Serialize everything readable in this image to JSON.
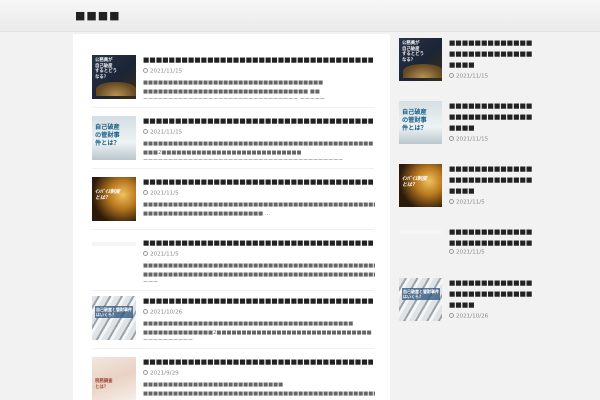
{
  "header": {
    "site_title": "■■■■"
  },
  "main": {
    "posts": [
      {
        "title": "■■■■■■■■■■■■■■■■■■■■■■■■■■■■■■■■■■■■■■■■",
        "date": "2021/11/15",
        "excerpt": "■■■■■■■■■■■■■■■■■■■■■■■■■■■■■■■■■■■■ ■■■■■■■■■■■■■■■■■■■■■■■■■■■■■■■■■ ■■ ■■■■■■■■■■■■■■■■■■■■■■■■■■■■■■■ ■■■■■ …",
        "thumb_text": "公務員が\n自己破産\nするとどう\nなる？"
      },
      {
        "title": "■■■■■■■■■■■■■■■■■■■■■■■■■■■■■■■■■■■■■■■■■■",
        "date": "2021/11/15",
        "excerpt": "■■■■■■■■■■■■■■■■■■■■■■■■■■■■■■■■■■■■■■■■■■■■■■ ■■■2■■■■■■■■■■■■■■■■■■■■■■■■■■■■ ■■■■■■■■■■■■■■■■■■■■■■■■■■■■■■■■■■■■■■■■ …",
        "thumb_text": "自己破産\nの管財事\n件とは？"
      },
      {
        "title": "■■■■■■■■■■■■■■■■■■■■■■■■■■■■■■■■■■■■■■■■",
        "date": "2021/11/5",
        "excerpt": "■■■■■■■■■■■■■■■■■■■■■■■■■■■■■■■■■■■■■■■■■■■■■■■■■■■■■■■■■■■■■■■■■■■■■■■■■■■■■■■■■■■■■ ■■■■■■■■■■■■■■■■■■■■■■■■ …",
        "thumb_text": "ｲﾝﾊﾞｲｽ制度\nとは？"
      },
      {
        "title": "■■■■■■■■■■■■■■■■■■■■■■■■■■■■■■■■■■■■■■",
        "date": "2021/11/5",
        "excerpt": "■■■■■■■■■■■■■■■■■■■■■■■■■■■■■■■■■■■■■■■■■■■■■■■■■ ■■■■■■■■■■■■■■■■■■■■■■■■■■■■■■■■■■■■■■■■■■■■■■■■■■ ■■■ …",
        "thumb_text": ""
      },
      {
        "title": "■■■■■■■■■■■■■■■■■■■■■■■■■■■■■■■■■■■■■■■■■",
        "date": "2021/10/26",
        "excerpt": "■■■■■■■■■■■■■■■■■■■■■■■■■■■■■■■■■■■■■■■■■■ ■■■■■■■■■■■■■■2■■■■■■■■■■■■■■■■■■■■■■■■■■■■■■■ ■■■■■■■■■■ …",
        "thumb_text": "自己破産と管財事件\nはいくら？"
      },
      {
        "title": "■■■■■■■■■■■■■■■■■■■■■■■■■■■■■■■■■■■■■■■■",
        "date": "2021/9/29",
        "excerpt": "■■■■■■■■■■■■■■■■■■■■■■■■■■■■ ■■■■■■■■■■■■■■■■■■■■■■■■■■■■■■■■■■■■■■■■■■■■■■■■■■■■■■■■■ ■■■■■■■■■■ …",
        "thumb_text": "税務調査\nとは？"
      }
    ]
  },
  "sidebar": {
    "items": [
      {
        "title": "■■■■■■■■■■■■■■■■■■■■■■■■■■■■■■",
        "date": "2021/11/15",
        "thumb_text": "公務員が\n自己破産\nするとどう\nなる？"
      },
      {
        "title": "■■■■■■■■■■■■■■■■■■■■■■■■■■■■■■",
        "date": "2021/11/15",
        "thumb_text": "自己破産\nの管財事\n件とは？"
      },
      {
        "title": "■■■■■■■■■■■■■■■■■■■■■■■■■■■■■■",
        "date": "2021/11/5",
        "thumb_text": "ｲﾝﾊﾞｲｽ制度\nとは？"
      },
      {
        "title": "■■■■■■■■■■■■■■■■■■■■■■■■■■■■■",
        "date": "2021/11/5",
        "thumb_text": ""
      },
      {
        "title": "■■■■■■■■■■■■■■■■■■■■■■■■■■■■■■",
        "date": "2021/10/26",
        "thumb_text": "自己破産と管財事件\nはいくら？"
      }
    ]
  },
  "icons": {
    "date": "clock-icon"
  }
}
